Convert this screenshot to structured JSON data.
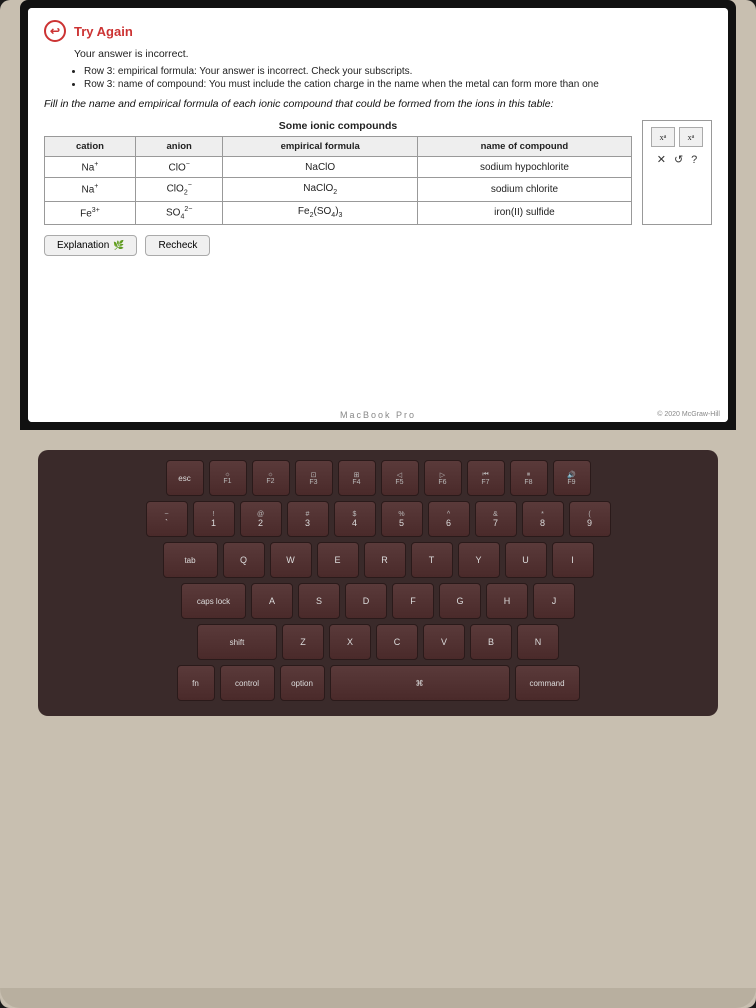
{
  "screen": {
    "try_again_title": "Try Again",
    "incorrect_text": "Your answer is incorrect.",
    "errors": [
      "Row 3: empirical formula: Your answer is incorrect. Check your subscripts.",
      "Row 3: name of compound: You must include the cation charge in the name when the metal can form more than one"
    ],
    "question": "Fill in the name and empirical formula of each ionic compound that could be formed from the ions in this table:",
    "table_caption": "Some ionic compounds",
    "table_headers": [
      "cation",
      "anion",
      "empirical formula",
      "name of compound"
    ],
    "table_rows": [
      {
        "cation": "Na⁺",
        "anion": "ClO⁻",
        "formula": "NaClO",
        "name": "sodium hypochlorite"
      },
      {
        "cation": "Na⁺",
        "anion": "ClO₂⁻",
        "formula": "NaClO₂",
        "name": "sodium chlorite"
      },
      {
        "cation": "Fe³⁺",
        "anion": "SO₄²⁻",
        "formula": "Fe₂(SO₄)₃",
        "name": "iron(II) sulfide"
      }
    ],
    "btn_explanation": "Explanation",
    "btn_recheck": "Recheck",
    "copyright": "© 2020 McGraw-Hill",
    "macbook_label": "MacBook Pro"
  },
  "keyboard": {
    "row_fn": [
      "esc",
      "F1",
      "F2",
      "F3",
      "F4",
      "F5",
      "F6",
      "F7",
      "F8",
      "F9"
    ],
    "row1": [
      [
        "~",
        "` "
      ],
      [
        "!",
        "1"
      ],
      [
        "@",
        "2"
      ],
      [
        "#",
        "3"
      ],
      [
        "$",
        "4"
      ],
      [
        "%",
        "5"
      ],
      [
        "^",
        "6"
      ],
      [
        "&",
        "7"
      ],
      [
        "*",
        "8"
      ],
      [
        "(",
        "9"
      ]
    ],
    "row2_labels": [
      "Q",
      "W",
      "E",
      "R",
      "T",
      "Y",
      "U",
      "I"
    ],
    "row3_labels": [
      "A",
      "S",
      "D",
      "F",
      "G",
      "H",
      "J"
    ],
    "row4_labels": [
      "Z",
      "X",
      "C",
      "V",
      "B",
      "N"
    ],
    "bottom_labels": [
      "fn",
      "control",
      "option",
      "command"
    ],
    "tab_label": "tab",
    "caps_label": "caps lock",
    "shift_label": "shift"
  }
}
